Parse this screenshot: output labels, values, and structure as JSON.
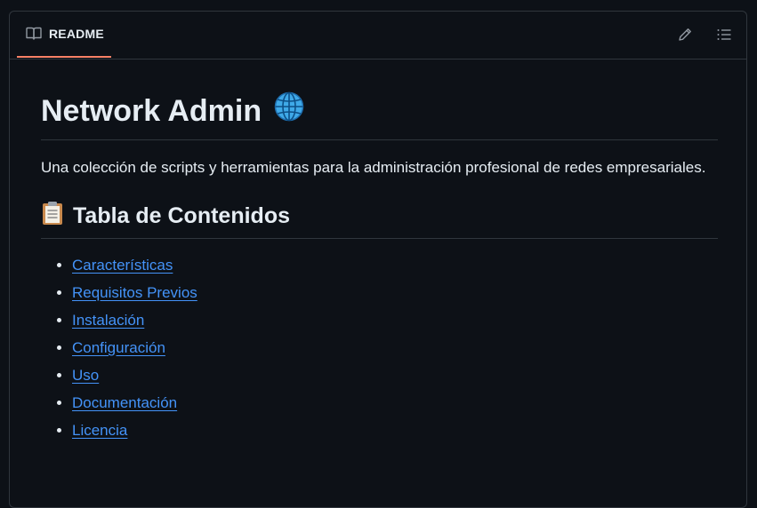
{
  "readme_header": {
    "tab_label": "README",
    "tab_icon": "book-icon",
    "edit_icon": "pencil-icon",
    "outline_icon": "list-icon",
    "accent_color": "#f78166"
  },
  "document": {
    "title": "Network Admin",
    "title_emoji": "globe-icon",
    "intro": "Una colección de scripts y herramientas para la administración profesional de redes empresariales.",
    "toc_heading": "Tabla de Contenidos",
    "toc_heading_emoji": "clipboard-icon",
    "toc_items": [
      {
        "label": "Características"
      },
      {
        "label": "Requisitos Previos"
      },
      {
        "label": "Instalación"
      },
      {
        "label": "Configuración"
      },
      {
        "label": "Uso"
      },
      {
        "label": "Documentación"
      },
      {
        "label": "Licencia"
      }
    ],
    "link_color": "#4493f8"
  }
}
